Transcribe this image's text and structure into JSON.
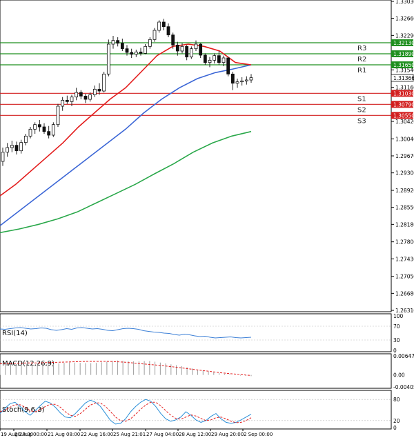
{
  "chart_data": {
    "type": "candlestick",
    "instrument_note": "",
    "colors": {
      "bull": "#2f9e2f",
      "bear": "#d21e1e",
      "ma_fast": "#e31b1b",
      "ma_mid": "#3b66d6",
      "ma_slow": "#2aa84a",
      "resistance": "#1f8f1f",
      "support": "#d21e1e",
      "rsi": "#3b7fd6",
      "macd_hist": "#9a9a9a",
      "macd_signal": "#e31b1b",
      "stoch_main": "#2b8fd8",
      "stoch_signal": "#e31b1b",
      "current_price_bg": "#ffffff"
    },
    "price_axis": {
      "ylim": [
        1.2631,
        1.3303
      ],
      "ticks": [
        "1.33030",
        "1.32660",
        "1.32290",
        "1.31920",
        "1.31540",
        "1.31160",
        "1.30420",
        "1.30040",
        "1.29670",
        "1.29300",
        "1.28920",
        "1.28550",
        "1.28180",
        "1.27800",
        "1.27430",
        "1.27050",
        "1.26680",
        "1.26310"
      ],
      "current_price": "1.31366"
    },
    "levels": [
      {
        "name": "R3",
        "value": 1.3213,
        "label": "1.32130",
        "kind": "resistance"
      },
      {
        "name": "R2",
        "value": 1.3189,
        "label": "1.31890",
        "kind": "resistance"
      },
      {
        "name": "R1",
        "value": 1.3165,
        "label": "1.31650",
        "kind": "resistance"
      },
      {
        "name": "S1",
        "value": 1.3103,
        "label": "1.31030",
        "kind": "support"
      },
      {
        "name": "S2",
        "value": 1.3079,
        "label": "1.30790",
        "kind": "support"
      },
      {
        "name": "S3",
        "value": 1.3055,
        "label": "1.30550",
        "kind": "support"
      }
    ],
    "x_ticks": [
      "19 Aug 20:00",
      "20 Aug 00:00",
      "21 Aug 08:00",
      "22 Aug 16:00",
      "25 Aug 21:01",
      "27 Aug 04:00",
      "28 Aug 12:00",
      "29 Aug 20:00",
      "2 Sep 00:00"
    ],
    "candles": [
      [
        1.2955,
        1.2985,
        1.2945,
        1.2975
      ],
      [
        1.2975,
        1.2995,
        1.2965,
        1.2985
      ],
      [
        1.2985,
        1.3,
        1.2975,
        1.299
      ],
      [
        1.299,
        1.2998,
        1.297,
        1.2978
      ],
      [
        1.2978,
        1.3002,
        1.2972,
        1.2996
      ],
      [
        1.2996,
        1.3015,
        1.299,
        1.301
      ],
      [
        1.301,
        1.303,
        1.3005,
        1.3025
      ],
      [
        1.3025,
        1.304,
        1.3015,
        1.3035
      ],
      [
        1.3035,
        1.3045,
        1.302,
        1.303
      ],
      [
        1.303,
        1.3038,
        1.3015,
        1.302
      ],
      [
        1.302,
        1.3032,
        1.3005,
        1.3012
      ],
      [
        1.3012,
        1.304,
        1.3008,
        1.3035
      ],
      [
        1.3035,
        1.308,
        1.303,
        1.3075
      ],
      [
        1.3075,
        1.3095,
        1.3065,
        1.3088
      ],
      [
        1.3088,
        1.3098,
        1.308,
        1.3085
      ],
      [
        1.3085,
        1.31,
        1.3075,
        1.3095
      ],
      [
        1.3095,
        1.3115,
        1.3088,
        1.3105
      ],
      [
        1.3105,
        1.311,
        1.309,
        1.3097
      ],
      [
        1.3097,
        1.3102,
        1.3082,
        1.309
      ],
      [
        1.309,
        1.3105,
        1.3085,
        1.31
      ],
      [
        1.31,
        1.312,
        1.3095,
        1.3112
      ],
      [
        1.3112,
        1.3125,
        1.31,
        1.3108
      ],
      [
        1.3108,
        1.315,
        1.3105,
        1.3145
      ],
      [
        1.3145,
        1.322,
        1.314,
        1.321
      ],
      [
        1.321,
        1.3228,
        1.32,
        1.3218
      ],
      [
        1.3218,
        1.3225,
        1.3205,
        1.3212
      ],
      [
        1.3212,
        1.3222,
        1.3195,
        1.32
      ],
      [
        1.32,
        1.3208,
        1.3185,
        1.3192
      ],
      [
        1.3192,
        1.32,
        1.318,
        1.3188
      ],
      [
        1.3188,
        1.3198,
        1.3182,
        1.3193
      ],
      [
        1.3193,
        1.3202,
        1.3185,
        1.319
      ],
      [
        1.319,
        1.321,
        1.3188,
        1.3205
      ],
      [
        1.3205,
        1.3225,
        1.32,
        1.322
      ],
      [
        1.322,
        1.3245,
        1.3215,
        1.324
      ],
      [
        1.324,
        1.3262,
        1.3235,
        1.3258
      ],
      [
        1.3258,
        1.3265,
        1.324,
        1.3248
      ],
      [
        1.3248,
        1.3255,
        1.3225,
        1.323
      ],
      [
        1.323,
        1.3235,
        1.32,
        1.3208
      ],
      [
        1.3208,
        1.3215,
        1.3185,
        1.3195
      ],
      [
        1.3195,
        1.3212,
        1.319,
        1.3205
      ],
      [
        1.3205,
        1.3208,
        1.3175,
        1.3182
      ],
      [
        1.3182,
        1.3205,
        1.3178,
        1.32
      ],
      [
        1.32,
        1.3218,
        1.3195,
        1.321
      ],
      [
        1.321,
        1.3212,
        1.318,
        1.3186
      ],
      [
        1.3186,
        1.319,
        1.3165,
        1.317
      ],
      [
        1.317,
        1.3182,
        1.316,
        1.3175
      ],
      [
        1.3175,
        1.319,
        1.3168,
        1.3185
      ],
      [
        1.3185,
        1.3195,
        1.3165,
        1.317
      ],
      [
        1.317,
        1.3185,
        1.3162,
        1.318
      ],
      [
        1.318,
        1.3182,
        1.314,
        1.3145
      ],
      [
        1.3145,
        1.315,
        1.311,
        1.3125
      ],
      [
        1.3125,
        1.3135,
        1.3115,
        1.3128
      ],
      [
        1.3128,
        1.3138,
        1.312,
        1.313
      ],
      [
        1.313,
        1.314,
        1.3122,
        1.3132
      ],
      [
        1.3132,
        1.3145,
        1.3126,
        1.3137
      ]
    ],
    "ma_fast": [
      1.288,
      1.2905,
      1.2935,
      1.2965,
      1.2995,
      1.303,
      1.306,
      1.309,
      1.3115,
      1.315,
      1.3185,
      1.3205,
      1.321,
      1.3205,
      1.3195,
      1.317,
      1.3165
    ],
    "ma_mid": [
      1.2815,
      1.2845,
      1.2875,
      1.2905,
      1.2935,
      1.2965,
      1.2995,
      1.3025,
      1.306,
      1.309,
      1.3115,
      1.3135,
      1.3148,
      1.3156,
      1.3165
    ],
    "ma_slow": [
      1.28,
      1.2808,
      1.2818,
      1.283,
      1.2845,
      1.2865,
      1.2885,
      1.2905,
      1.2928,
      1.295,
      1.2975,
      1.2995,
      1.301,
      1.302
    ],
    "rsi": {
      "label": "RSI(14)",
      "ticks": [
        "100",
        "70",
        "30",
        "0"
      ],
      "values": [
        62,
        61,
        63,
        65,
        66,
        64,
        62,
        63,
        65,
        64,
        60,
        58,
        60,
        63,
        61,
        65,
        66,
        64,
        62,
        63,
        61,
        58,
        57,
        60,
        63,
        64,
        63,
        61,
        57,
        55,
        53,
        52,
        50,
        49,
        46,
        44,
        47,
        45,
        42,
        40,
        41,
        38,
        36,
        37,
        38,
        39,
        37,
        36,
        37,
        38
      ]
    },
    "macd": {
      "label": "MACD(12,26,9)",
      "ticks": [
        "0.006477",
        "0.00",
        "-0.004058"
      ],
      "hist": [
        0.0036,
        0.0037,
        0.0038,
        0.0037,
        0.0036,
        0.0038,
        0.004,
        0.0041,
        0.0041,
        0.0039,
        0.0038,
        0.0039,
        0.0041,
        0.0042,
        0.0042,
        0.0041,
        0.004,
        0.004,
        0.0041,
        0.0043,
        0.0045,
        0.0048,
        0.0049,
        0.0048,
        0.0047,
        0.0046,
        0.0046,
        0.0047,
        0.0047,
        0.0045,
        0.0042,
        0.0039,
        0.0036,
        0.0033,
        0.003,
        0.0026,
        0.0022,
        0.0018,
        0.0015,
        0.0012,
        0.0009,
        0.0006,
        0.0004,
        0.0002,
        0.0,
        -0.0002,
        -0.0003,
        -0.0004
      ],
      "signal": [
        0.0038,
        0.0039,
        0.004,
        0.0041,
        0.0041,
        0.0042,
        0.0043,
        0.0044,
        0.0045,
        0.0046,
        0.0046,
        0.0046,
        0.0045,
        0.0043,
        0.004,
        0.0037,
        0.0034,
        0.0031,
        0.0027,
        0.0023,
        0.0019,
        0.0015,
        0.0011,
        0.0007,
        0.0004,
        0.0001,
        -0.0002
      ]
    },
    "stoch": {
      "label": "Stoch(9,6,3)",
      "ticks": [
        "80",
        "20",
        "0"
      ],
      "main": [
        40,
        55,
        68,
        72,
        60,
        45,
        35,
        48,
        62,
        75,
        70,
        58,
        42,
        30,
        28,
        40,
        55,
        70,
        78,
        72,
        60,
        40,
        20,
        10,
        12,
        25,
        45,
        60,
        72,
        80,
        75,
        60,
        40,
        25,
        18,
        22,
        30,
        45,
        35,
        22,
        15,
        20,
        32,
        40,
        25,
        15,
        12,
        15,
        22,
        30,
        38
      ],
      "signal": [
        45,
        50,
        58,
        65,
        65,
        58,
        48,
        45,
        50,
        60,
        66,
        66,
        58,
        45,
        35,
        32,
        40,
        52,
        64,
        70,
        70,
        60,
        45,
        30,
        20,
        18,
        25,
        38,
        52,
        64,
        72,
        72,
        62,
        48,
        35,
        26,
        24,
        30,
        36,
        33,
        26,
        20,
        22,
        28,
        30,
        25,
        18,
        14,
        15,
        20,
        28
      ]
    }
  }
}
